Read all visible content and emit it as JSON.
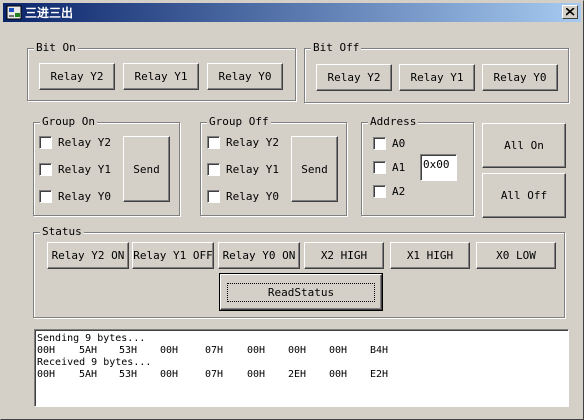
{
  "window": {
    "title": "三进三出"
  },
  "bit_on": {
    "label": "Bit On",
    "buttons": [
      "Relay Y2",
      "Relay Y1",
      "Relay Y0"
    ]
  },
  "bit_off": {
    "label": "Bit Off",
    "buttons": [
      "Relay Y2",
      "Relay Y1",
      "Relay Y0"
    ]
  },
  "group_on": {
    "label": "Group On",
    "checks": [
      "Relay Y2",
      "Relay Y1",
      "Relay Y0"
    ],
    "send": "Send"
  },
  "group_off": {
    "label": "Group Off",
    "checks": [
      "Relay Y2",
      "Relay Y1",
      "Relay Y0"
    ],
    "send": "Send"
  },
  "address": {
    "label": "Address",
    "checks": [
      "A0",
      "A1",
      "A2"
    ],
    "value": "0x00"
  },
  "all": {
    "on": "All On",
    "off": "All Off"
  },
  "status": {
    "label": "Status",
    "buttons": [
      "Relay Y2 ON",
      "Relay Y1 OFF",
      "Relay Y0 ON",
      "X2 HIGH",
      "X1 HIGH",
      "X0 LOW"
    ],
    "read": "ReadStatus"
  },
  "log": [
    {
      "header": "Sending 9 bytes...",
      "bytes": [
        "00H",
        "5AH",
        "53H",
        "00H",
        "07H",
        "00H",
        "00H",
        "00H",
        "B4H"
      ]
    },
    {
      "header": "Received 9 bytes...",
      "bytes": [
        "00H",
        "5AH",
        "53H",
        "00H",
        "07H",
        "00H",
        "2EH",
        "00H",
        "E2H"
      ]
    }
  ]
}
